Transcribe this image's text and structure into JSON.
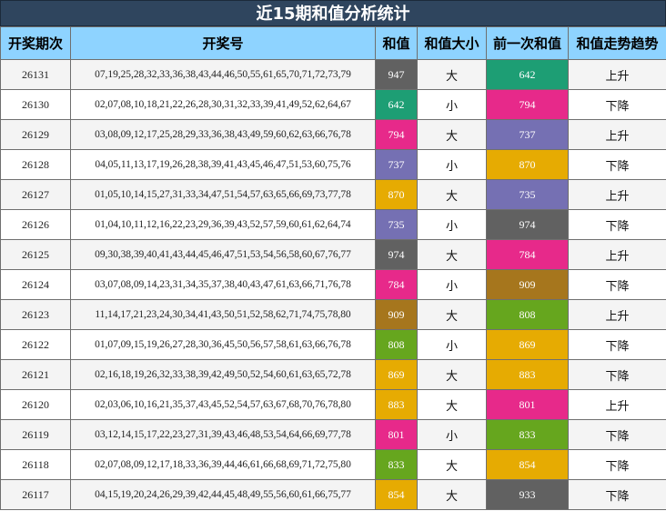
{
  "title": "近15期和值分析统计",
  "headers": [
    "开奖期次",
    "开奖号",
    "和值",
    "和值大小",
    "前一次和值",
    "和值走势趋势"
  ],
  "rows": [
    {
      "issue": "26131",
      "numbers": "07,19,25,28,32,33,36,38,43,44,46,50,55,61,65,70,71,72,73,79",
      "sum": "947",
      "sum_color": "#616161",
      "size": "大",
      "prev": "642",
      "prev_color": "#1d9e74",
      "trend": "上升"
    },
    {
      "issue": "26130",
      "numbers": "02,07,08,10,18,21,22,26,28,30,31,32,33,39,41,49,52,62,64,67",
      "sum": "642",
      "sum_color": "#1d9e74",
      "size": "小",
      "prev": "794",
      "prev_color": "#e7298a",
      "trend": "下降"
    },
    {
      "issue": "26129",
      "numbers": "03,08,09,12,17,25,28,29,33,36,38,43,49,59,60,62,63,66,76,78",
      "sum": "794",
      "sum_color": "#e7298a",
      "size": "大",
      "prev": "737",
      "prev_color": "#7570b3",
      "trend": "上升"
    },
    {
      "issue": "26128",
      "numbers": "04,05,11,13,17,19,26,28,38,39,41,43,45,46,47,51,53,60,75,76",
      "sum": "737",
      "sum_color": "#7570b3",
      "size": "小",
      "prev": "870",
      "prev_color": "#e6ab02",
      "trend": "下降"
    },
    {
      "issue": "26127",
      "numbers": "01,05,10,14,15,27,31,33,34,47,51,54,57,63,65,66,69,73,77,78",
      "sum": "870",
      "sum_color": "#e6ab02",
      "size": "大",
      "prev": "735",
      "prev_color": "#7570b3",
      "trend": "上升"
    },
    {
      "issue": "26126",
      "numbers": "01,04,10,11,12,16,22,23,29,36,39,43,52,57,59,60,61,62,64,74",
      "sum": "735",
      "sum_color": "#7570b3",
      "size": "小",
      "prev": "974",
      "prev_color": "#616161",
      "trend": "下降"
    },
    {
      "issue": "26125",
      "numbers": "09,30,38,39,40,41,43,44,45,46,47,51,53,54,56,58,60,67,76,77",
      "sum": "974",
      "sum_color": "#616161",
      "size": "大",
      "prev": "784",
      "prev_color": "#e7298a",
      "trend": "上升"
    },
    {
      "issue": "26124",
      "numbers": "03,07,08,09,14,23,31,34,35,37,38,40,43,47,61,63,66,71,76,78",
      "sum": "784",
      "sum_color": "#e7298a",
      "size": "小",
      "prev": "909",
      "prev_color": "#a6761d",
      "trend": "下降"
    },
    {
      "issue": "26123",
      "numbers": "11,14,17,21,23,24,30,34,41,43,50,51,52,58,62,71,74,75,78,80",
      "sum": "909",
      "sum_color": "#a6761d",
      "size": "大",
      "prev": "808",
      "prev_color": "#66a61e",
      "trend": "上升"
    },
    {
      "issue": "26122",
      "numbers": "01,07,09,15,19,26,27,28,30,36,45,50,56,57,58,61,63,66,76,78",
      "sum": "808",
      "sum_color": "#66a61e",
      "size": "小",
      "prev": "869",
      "prev_color": "#e6ab02",
      "trend": "下降"
    },
    {
      "issue": "26121",
      "numbers": "02,16,18,19,26,32,33,38,39,42,49,50,52,54,60,61,63,65,72,78",
      "sum": "869",
      "sum_color": "#e6ab02",
      "size": "大",
      "prev": "883",
      "prev_color": "#e6ab02",
      "trend": "下降"
    },
    {
      "issue": "26120",
      "numbers": "02,03,06,10,16,21,35,37,43,45,52,54,57,63,67,68,70,76,78,80",
      "sum": "883",
      "sum_color": "#e6ab02",
      "size": "大",
      "prev": "801",
      "prev_color": "#e7298a",
      "trend": "上升"
    },
    {
      "issue": "26119",
      "numbers": "03,12,14,15,17,22,23,27,31,39,43,46,48,53,54,64,66,69,77,78",
      "sum": "801",
      "sum_color": "#e7298a",
      "size": "小",
      "prev": "833",
      "prev_color": "#66a61e",
      "trend": "下降"
    },
    {
      "issue": "26118",
      "numbers": "02,07,08,09,12,17,18,33,36,39,44,46,61,66,68,69,71,72,75,80",
      "sum": "833",
      "sum_color": "#66a61e",
      "size": "大",
      "prev": "854",
      "prev_color": "#e6ab02",
      "trend": "下降"
    },
    {
      "issue": "26117",
      "numbers": "04,15,19,20,24,26,29,39,42,44,45,48,49,55,56,60,61,66,75,77",
      "sum": "854",
      "sum_color": "#e6ab02",
      "size": "大",
      "prev": "933",
      "prev_color": "#616161",
      "trend": "下降"
    }
  ]
}
